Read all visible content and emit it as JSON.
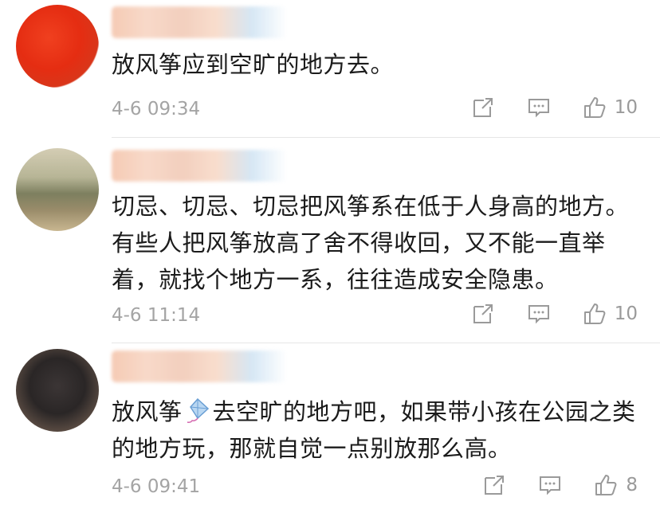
{
  "comments": [
    {
      "text": "放风筝应到空旷的地方去。",
      "time": "4-6 09:34",
      "likes": "10"
    },
    {
      "text": "切忌、切忌、切忌把风筝系在低于人身高的地方。有些人把风筝放高了舍不得收回，又不能一直举着，就找个地方一系，往往造成安全隐患。",
      "time": "4-6 11:14",
      "likes": "10"
    },
    {
      "text_before": "放风筝",
      "text_after": "去空旷的地方吧，如果带小孩在公园之类的地方玩，那就自觉一点别放那么高。",
      "emoji": "kite-emoji",
      "time": "4-6 09:41",
      "likes": "8"
    }
  ],
  "icons": {
    "share": "share-icon",
    "reply": "comment-icon",
    "like": "thumbs-up-icon"
  },
  "colors": {
    "text": "#1b1b1b",
    "meta": "#a4a4a4",
    "icon": "#9a9a9a"
  }
}
